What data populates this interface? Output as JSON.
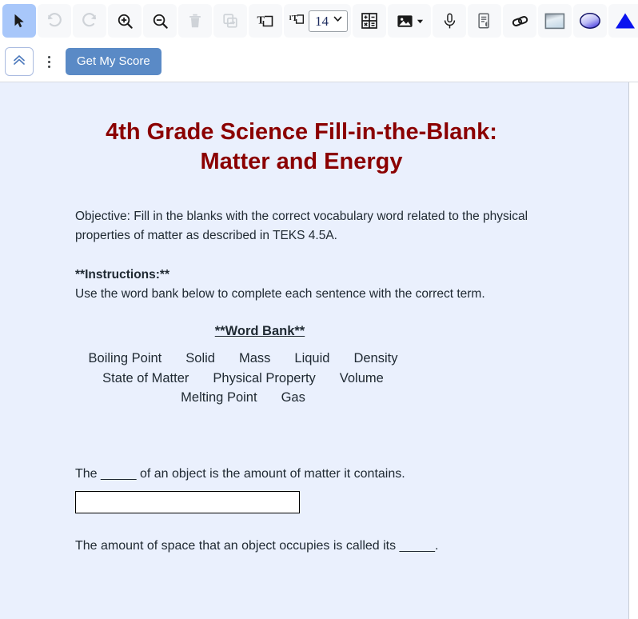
{
  "toolbar": {
    "row1": [
      {
        "name": "select-tool",
        "icon": "cursor-arrow-icon",
        "state": "active",
        "label": "Select"
      },
      {
        "name": "undo-button",
        "icon": "undo-icon",
        "state": "disabled",
        "label": "Undo"
      },
      {
        "name": "redo-button",
        "icon": "redo-icon",
        "state": "disabled",
        "label": "Redo"
      },
      {
        "name": "zoom-in-button",
        "icon": "zoom-in-icon",
        "state": "enabled",
        "label": "Zoom In"
      },
      {
        "name": "zoom-out-button",
        "icon": "zoom-out-icon",
        "state": "enabled",
        "label": "Zoom Out"
      },
      {
        "name": "delete-button",
        "icon": "trash-icon",
        "state": "disabled",
        "label": "Delete"
      },
      {
        "name": "duplicate-button",
        "icon": "duplicate-icon",
        "state": "disabled",
        "label": "Duplicate"
      },
      {
        "name": "add-text-button",
        "icon": "text-box-icon",
        "state": "enabled",
        "label": "Add Text"
      },
      {
        "name": "font-size-control",
        "icon": "text-size-icon",
        "state": "enabled",
        "label": "Font Size"
      },
      {
        "name": "equation-button",
        "icon": "math-grid-icon",
        "state": "enabled",
        "label": "Equation"
      },
      {
        "name": "insert-image-button",
        "icon": "image-icon",
        "state": "enabled",
        "label": "Insert Image"
      },
      {
        "name": "record-audio-button",
        "icon": "microphone-icon",
        "state": "enabled",
        "label": "Record Audio"
      },
      {
        "name": "read-aloud-button",
        "icon": "document-audio-icon",
        "state": "enabled",
        "label": "Read Aloud"
      },
      {
        "name": "insert-link-button",
        "icon": "link-icon",
        "state": "enabled",
        "label": "Insert Link"
      },
      {
        "name": "rectangle-shape-button",
        "icon": "rectangle-shape-icon",
        "state": "enabled",
        "label": "Rectangle"
      },
      {
        "name": "ellipse-shape-button",
        "icon": "ellipse-shape-icon",
        "state": "enabled",
        "label": "Ellipse"
      },
      {
        "name": "triangle-shape-button",
        "icon": "triangle-shape-icon",
        "state": "enabled",
        "label": "Triangle"
      }
    ],
    "font_size_value": "14",
    "collapse_label": "Collapse toolbar",
    "collapse_icon": "double-chevron-up-icon",
    "more_options_icon": "kebab-menu-icon",
    "get_score_label": "Get My Score",
    "accent_color": "#5a8ac6",
    "active_tool_color": "#a8c7fa"
  },
  "document": {
    "background_color": "#eaf0fd",
    "title": "4th Grade Science Fill-in-the-Blank: Matter and Energy",
    "title_color": "#8b0000",
    "objective": "Objective: Fill in the blanks with the correct vocabulary word related to the physical properties of matter as described in TEKS 4.5A.",
    "instructions_heading": "**Instructions:**",
    "instructions_body": "Use the word bank below to complete each sentence with the correct term.",
    "word_bank": {
      "heading": "**Word Bank**",
      "line1": [
        "Boiling Point",
        "Solid",
        "Mass",
        "Liquid",
        "Density"
      ],
      "line2": [
        "State of Matter",
        "Physical Property",
        "Volume"
      ],
      "line3": [
        "Melting Point",
        "Gas"
      ]
    },
    "questions": [
      {
        "text": "The _____ of an object is the amount of matter it contains.",
        "answer_value": "",
        "answer_placeholder": ""
      },
      {
        "text": "The amount of space that an object occupies is called its _____.",
        "answer_value": "",
        "answer_placeholder": ""
      }
    ]
  }
}
